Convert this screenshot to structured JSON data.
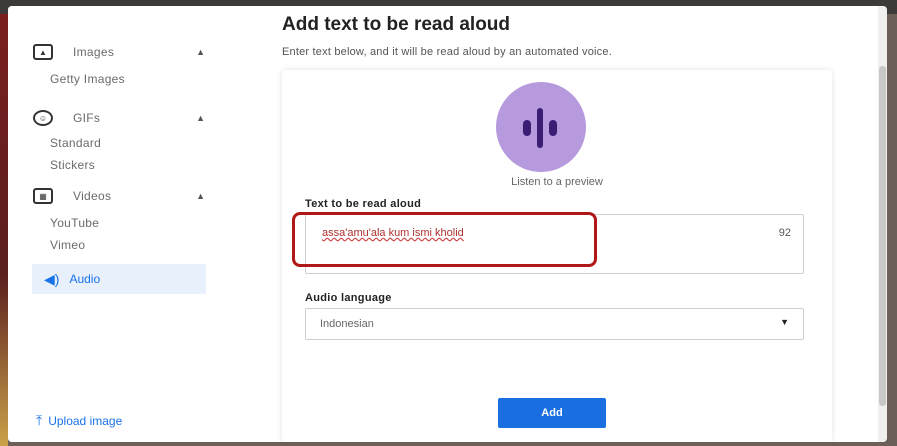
{
  "sidebar": {
    "sections": [
      {
        "label": "Images",
        "icon": "image-icon",
        "sub": [
          "Getty Images"
        ]
      },
      {
        "label": "GIFs",
        "icon": "gif-icon",
        "sub": [
          "Standard",
          "Stickers"
        ]
      },
      {
        "label": "Videos",
        "icon": "video-icon",
        "sub": [
          "YouTube",
          "Vimeo"
        ]
      }
    ],
    "audio_label": "Audio",
    "upload_label": "Upload image"
  },
  "main": {
    "title": "Add text to be read aloud",
    "subtitle": "Enter text below, and it will be read aloud by an automated voice.",
    "preview_label": "Listen to a preview",
    "text_label": "Text to be read aloud",
    "text_value": "assa'amu'ala kum ismi kholid",
    "char_count": "92",
    "language_label": "Audio language",
    "language_value": "Indonesian",
    "add_button": "Add"
  },
  "colors": {
    "accent": "#1a73e8",
    "avatar_bg": "#b79add",
    "avatar_bars": "#3b1e74",
    "highlight": "#b01818"
  }
}
